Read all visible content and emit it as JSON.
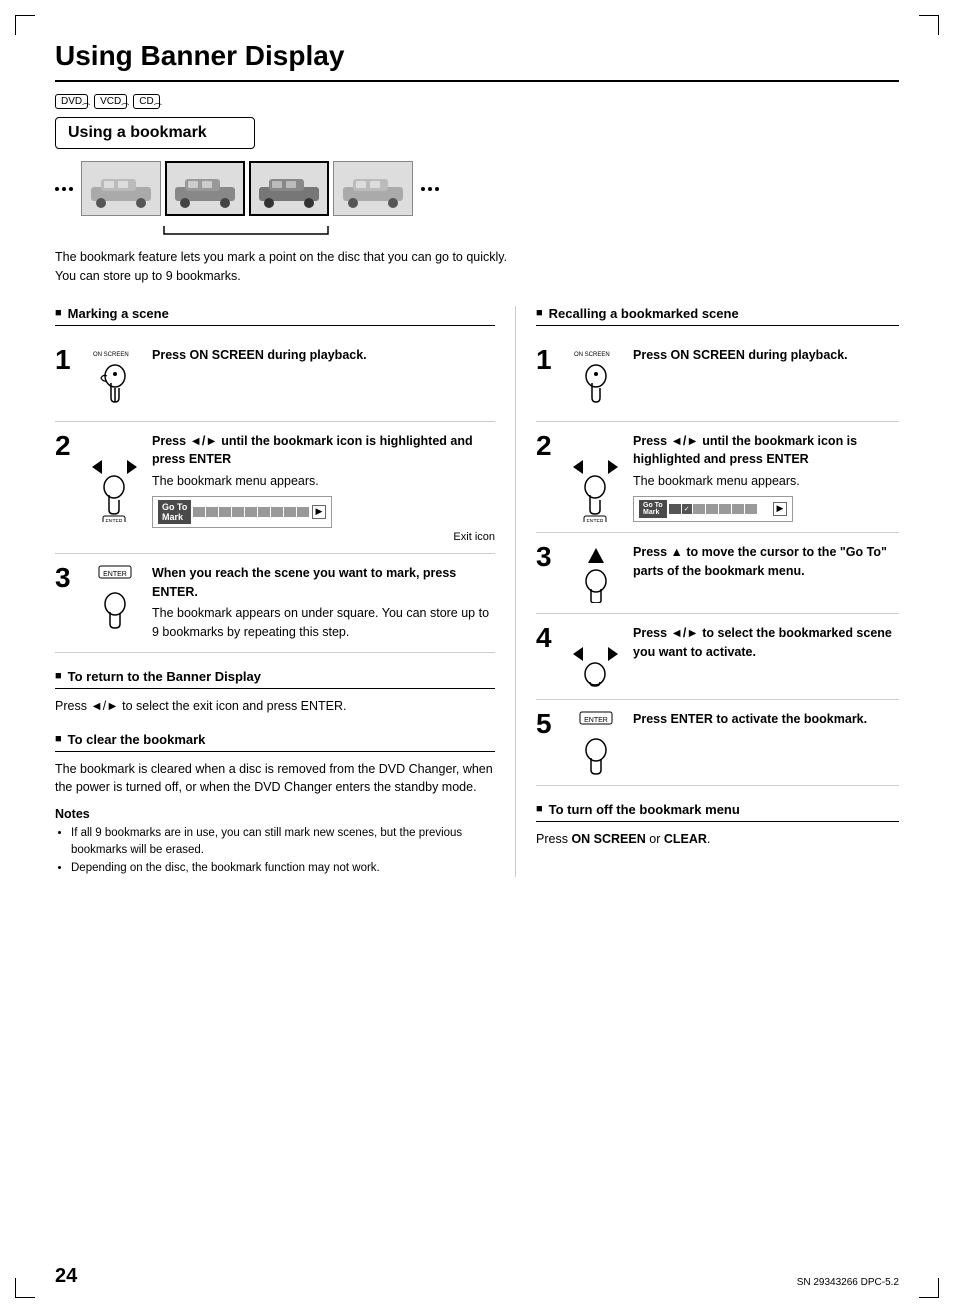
{
  "page": {
    "title": "Using Banner Display",
    "page_number": "24",
    "doc_number": "SN 29343266 DPC-5.2"
  },
  "disc_icons": [
    "DVD",
    "VCD",
    "CD"
  ],
  "bookmark_section": {
    "title": "Using a bookmark",
    "description": "The bookmark feature lets you mark a point on the disc that you can go to quickly. You can store up to 9 bookmarks."
  },
  "marking_section": {
    "heading": "Marking a scene",
    "steps": [
      {
        "number": "1",
        "instruction_bold": "Press ON SCREEN during playback."
      },
      {
        "number": "2",
        "instruction_bold": "Press ◄/► until the bookmark icon is highlighted and press ENTER",
        "instruction_normal": "The bookmark menu appears.",
        "has_menu_img": true,
        "exit_icon_label": "Exit icon"
      },
      {
        "number": "3",
        "instruction_bold": "When you reach the scene you want to mark, press ENTER.",
        "instruction_normal": "The bookmark appears on under square. You can store up to 9 bookmarks by repeating this step."
      }
    ]
  },
  "return_section": {
    "heading": "To return to the Banner Display",
    "text": "Press ◄/► to select the exit icon and press ENTER."
  },
  "clear_section": {
    "heading": "To clear the bookmark",
    "text": "The bookmark is cleared when a disc is removed from the DVD Changer, when the power is turned off, or when the DVD Changer enters the standby mode."
  },
  "notes": {
    "title": "Notes",
    "items": [
      "If all 9 bookmarks are in use, you can still mark new scenes, but the previous bookmarks will be erased.",
      "Depending on the disc, the bookmark function may not work."
    ]
  },
  "recalling_section": {
    "heading": "Recalling a bookmarked scene",
    "steps": [
      {
        "number": "1",
        "instruction_bold": "Press ON SCREEN during playback."
      },
      {
        "number": "2",
        "instruction_bold": "Press ◄/► until the bookmark icon is highlighted and press ENTER",
        "instruction_normal": "The bookmark menu appears.",
        "has_menu_img": true
      },
      {
        "number": "3",
        "instruction_bold": "Press ▲ to move the cursor to the \"Go To\" parts of the bookmark menu."
      },
      {
        "number": "4",
        "instruction_bold": "Press ◄/► to select the bookmarked scene you want to activate."
      },
      {
        "number": "5",
        "instruction_bold": "Press ENTER to activate the bookmark."
      }
    ]
  },
  "turnoff_section": {
    "heading": "To turn off the bookmark menu",
    "text": "Press ON SCREEN or CLEAR."
  }
}
